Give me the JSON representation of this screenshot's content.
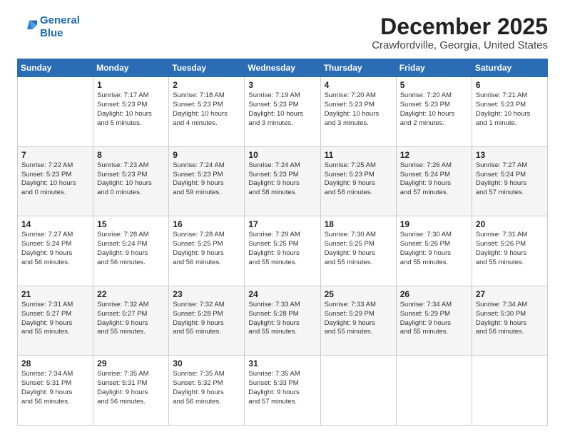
{
  "logo": {
    "line1": "General",
    "line2": "Blue"
  },
  "title": "December 2025",
  "subtitle": "Crawfordville, Georgia, United States",
  "days_header": [
    "Sunday",
    "Monday",
    "Tuesday",
    "Wednesday",
    "Thursday",
    "Friday",
    "Saturday"
  ],
  "weeks": [
    [
      {
        "day": "",
        "text": ""
      },
      {
        "day": "1",
        "text": "Sunrise: 7:17 AM\nSunset: 5:23 PM\nDaylight: 10 hours\nand 5 minutes."
      },
      {
        "day": "2",
        "text": "Sunrise: 7:18 AM\nSunset: 5:23 PM\nDaylight: 10 hours\nand 4 minutes."
      },
      {
        "day": "3",
        "text": "Sunrise: 7:19 AM\nSunset: 5:23 PM\nDaylight: 10 hours\nand 3 minutes."
      },
      {
        "day": "4",
        "text": "Sunrise: 7:20 AM\nSunset: 5:23 PM\nDaylight: 10 hours\nand 3 minutes."
      },
      {
        "day": "5",
        "text": "Sunrise: 7:20 AM\nSunset: 5:23 PM\nDaylight: 10 hours\nand 2 minutes."
      },
      {
        "day": "6",
        "text": "Sunrise: 7:21 AM\nSunset: 5:23 PM\nDaylight: 10 hours\nand 1 minute."
      }
    ],
    [
      {
        "day": "7",
        "text": "Sunrise: 7:22 AM\nSunset: 5:23 PM\nDaylight: 10 hours\nand 0 minutes."
      },
      {
        "day": "8",
        "text": "Sunrise: 7:23 AM\nSunset: 5:23 PM\nDaylight: 10 hours\nand 0 minutes."
      },
      {
        "day": "9",
        "text": "Sunrise: 7:24 AM\nSunset: 5:23 PM\nDaylight: 9 hours\nand 59 minutes."
      },
      {
        "day": "10",
        "text": "Sunrise: 7:24 AM\nSunset: 5:23 PM\nDaylight: 9 hours\nand 58 minutes."
      },
      {
        "day": "11",
        "text": "Sunrise: 7:25 AM\nSunset: 5:23 PM\nDaylight: 9 hours\nand 58 minutes."
      },
      {
        "day": "12",
        "text": "Sunrise: 7:26 AM\nSunset: 5:24 PM\nDaylight: 9 hours\nand 57 minutes."
      },
      {
        "day": "13",
        "text": "Sunrise: 7:27 AM\nSunset: 5:24 PM\nDaylight: 9 hours\nand 57 minutes."
      }
    ],
    [
      {
        "day": "14",
        "text": "Sunrise: 7:27 AM\nSunset: 5:24 PM\nDaylight: 9 hours\nand 56 minutes."
      },
      {
        "day": "15",
        "text": "Sunrise: 7:28 AM\nSunset: 5:24 PM\nDaylight: 9 hours\nand 56 minutes."
      },
      {
        "day": "16",
        "text": "Sunrise: 7:28 AM\nSunset: 5:25 PM\nDaylight: 9 hours\nand 56 minutes."
      },
      {
        "day": "17",
        "text": "Sunrise: 7:29 AM\nSunset: 5:25 PM\nDaylight: 9 hours\nand 55 minutes."
      },
      {
        "day": "18",
        "text": "Sunrise: 7:30 AM\nSunset: 5:25 PM\nDaylight: 9 hours\nand 55 minutes."
      },
      {
        "day": "19",
        "text": "Sunrise: 7:30 AM\nSunset: 5:26 PM\nDaylight: 9 hours\nand 55 minutes."
      },
      {
        "day": "20",
        "text": "Sunrise: 7:31 AM\nSunset: 5:26 PM\nDaylight: 9 hours\nand 55 minutes."
      }
    ],
    [
      {
        "day": "21",
        "text": "Sunrise: 7:31 AM\nSunset: 5:27 PM\nDaylight: 9 hours\nand 55 minutes."
      },
      {
        "day": "22",
        "text": "Sunrise: 7:32 AM\nSunset: 5:27 PM\nDaylight: 9 hours\nand 55 minutes."
      },
      {
        "day": "23",
        "text": "Sunrise: 7:32 AM\nSunset: 5:28 PM\nDaylight: 9 hours\nand 55 minutes."
      },
      {
        "day": "24",
        "text": "Sunrise: 7:33 AM\nSunset: 5:28 PM\nDaylight: 9 hours\nand 55 minutes."
      },
      {
        "day": "25",
        "text": "Sunrise: 7:33 AM\nSunset: 5:29 PM\nDaylight: 9 hours\nand 55 minutes."
      },
      {
        "day": "26",
        "text": "Sunrise: 7:34 AM\nSunset: 5:29 PM\nDaylight: 9 hours\nand 55 minutes."
      },
      {
        "day": "27",
        "text": "Sunrise: 7:34 AM\nSunset: 5:30 PM\nDaylight: 9 hours\nand 56 minutes."
      }
    ],
    [
      {
        "day": "28",
        "text": "Sunrise: 7:34 AM\nSunset: 5:31 PM\nDaylight: 9 hours\nand 56 minutes."
      },
      {
        "day": "29",
        "text": "Sunrise: 7:35 AM\nSunset: 5:31 PM\nDaylight: 9 hours\nand 56 minutes."
      },
      {
        "day": "30",
        "text": "Sunrise: 7:35 AM\nSunset: 5:32 PM\nDaylight: 9 hours\nand 56 minutes."
      },
      {
        "day": "31",
        "text": "Sunrise: 7:35 AM\nSunset: 5:33 PM\nDaylight: 9 hours\nand 57 minutes."
      },
      {
        "day": "",
        "text": ""
      },
      {
        "day": "",
        "text": ""
      },
      {
        "day": "",
        "text": ""
      }
    ]
  ]
}
